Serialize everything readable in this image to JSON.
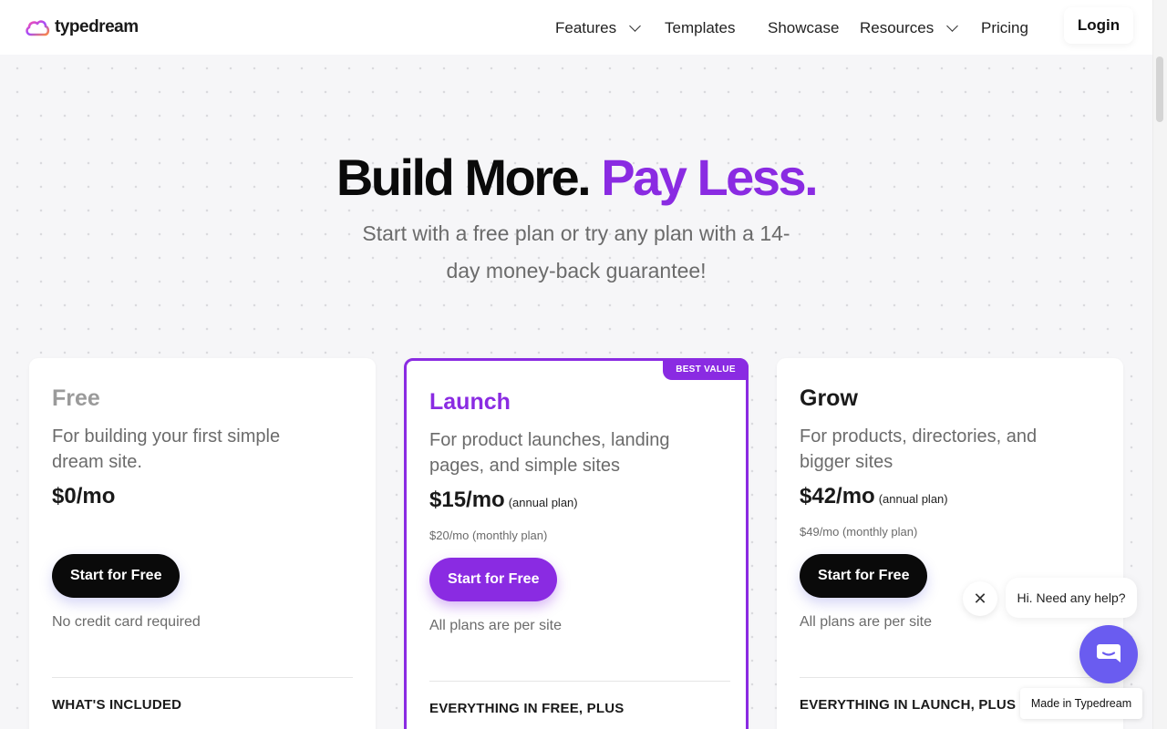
{
  "nav": {
    "brand": "typedream",
    "items": [
      {
        "label": "Features",
        "has_dropdown": true
      },
      {
        "label": "Templates",
        "has_dropdown": false
      },
      {
        "label": "Showcase",
        "has_dropdown": false
      },
      {
        "label": "Resources",
        "has_dropdown": true
      },
      {
        "label": "Pricing",
        "has_dropdown": false
      }
    ],
    "login": "Login"
  },
  "hero": {
    "title_main": "Build More.",
    "title_accent": "Pay Less.",
    "subtitle": "Start with a free plan or try any plan with a 14-day money-back guarantee!"
  },
  "plans": [
    {
      "name": "Free",
      "description": "For building your first simple dream site.",
      "price": "$0/mo",
      "price_note": "",
      "monthly": "",
      "cta": "Start for Free",
      "note": "No credit card required",
      "included_heading": "WHAT'S INCLUDED"
    },
    {
      "name": "Launch",
      "badge": "BEST VALUE",
      "description": "For product launches, landing pages, and simple sites",
      "price": "$15/mo",
      "price_note": "(annual plan)",
      "monthly": "$20/mo (monthly plan)",
      "cta": "Start for Free",
      "note": "All plans are per site",
      "included_heading": "EVERYTHING IN FREE, PLUS"
    },
    {
      "name": "Grow",
      "description": "For products, directories, and bigger sites",
      "price": "$42/mo",
      "price_note": "(annual plan)",
      "monthly": "$49/mo (monthly plan)",
      "cta": "Start for Free",
      "note": "All plans are per site",
      "included_heading": "EVERYTHING IN LAUNCH, PLUS"
    }
  ],
  "chat": {
    "close_symbol": "✕",
    "message": "Hi. Need any help?"
  },
  "footer_badge": "Made in Typedream",
  "colors": {
    "accent": "#8a2be2",
    "chat": "#6a5cf0"
  }
}
